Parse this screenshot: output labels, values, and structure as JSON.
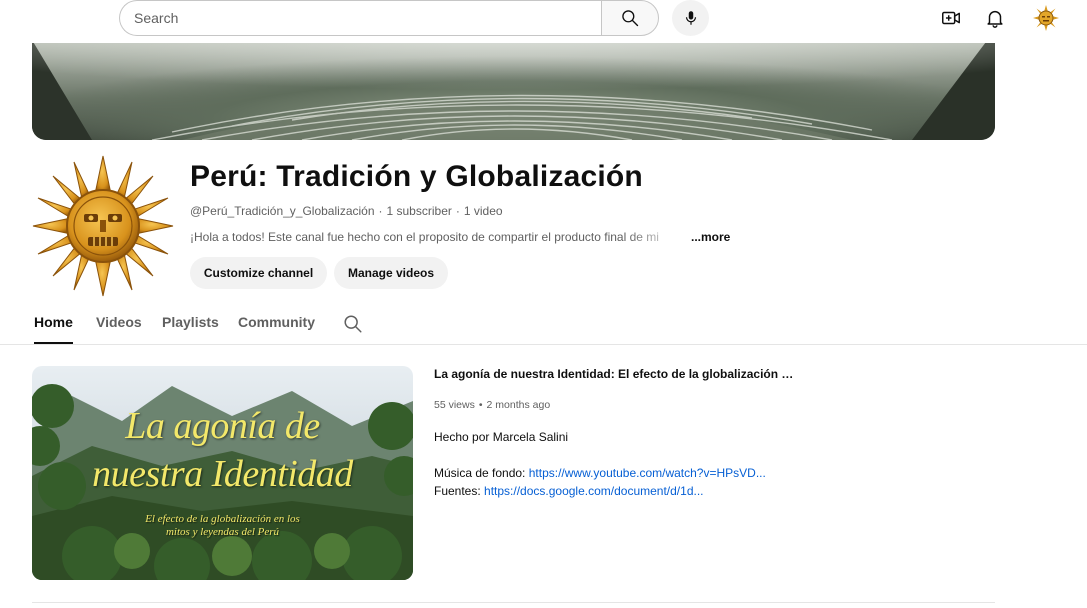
{
  "search": {
    "placeholder": "Search"
  },
  "header": {
    "icons": [
      "search-icon",
      "microphone-icon",
      "create-icon",
      "notifications-icon",
      "account-avatar"
    ]
  },
  "channel": {
    "name": "Perú: Tradición y Globalización",
    "handle": "@Perú_Tradición_y_Globalización",
    "subscribers": "1 subscriber",
    "videos": "1 video",
    "separator": "·",
    "description": "¡Hola a todos! Este canal fue hecho con el proposito de compartir el producto final de mi",
    "more_label": "...more",
    "customize_label": "Customize channel",
    "manage_label": "Manage videos"
  },
  "tabs": [
    {
      "label": "Home",
      "active": true
    },
    {
      "label": "Videos",
      "active": false
    },
    {
      "label": "Playlists",
      "active": false
    },
    {
      "label": "Community",
      "active": false
    }
  ],
  "featured": {
    "thumbnail_title_line1": "La agonía de",
    "thumbnail_title_line2": "nuestra Identidad",
    "thumbnail_sub_line1": "El efecto de la globalización en los",
    "thumbnail_sub_line2": "mitos y leyendas del Perú",
    "title": "La agonía de nuestra Identidad: El efecto de la globalización e...",
    "views": "55 views",
    "stat_separator": "•",
    "age": "2 months ago",
    "made_by": "Hecho por Marcela Salini",
    "music_label": "Música de fondo: ",
    "music_link": "https://www.youtube.com/watch?v=HPsVD...",
    "sources_label": "Fuentes: ",
    "sources_link": "https://docs.google.com/document/d/1d..."
  },
  "colors": {
    "text_primary": "#0f0f0f",
    "text_secondary": "#606060",
    "link": "#065fd4",
    "pill_bg": "#f2f2f2",
    "thumbnail_text": "#f3e86a",
    "sun_gold": "#d99a1f"
  }
}
